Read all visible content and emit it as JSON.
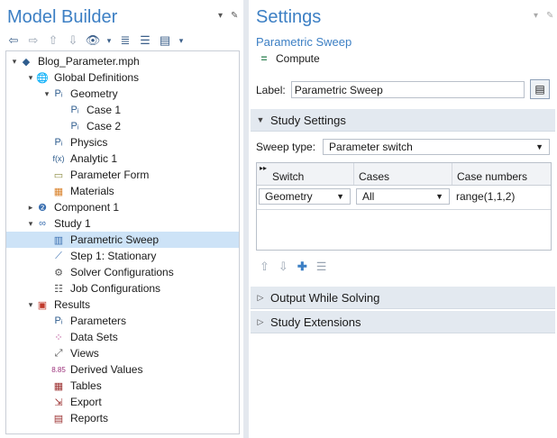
{
  "model_builder": {
    "title": "Model Builder",
    "tree": [
      {
        "label": "Blog_Parameter.mph",
        "icon": "model-file-icon",
        "toggle": "▾"
      },
      {
        "label": "Global Definitions",
        "icon": "globe-icon",
        "toggle": "▾"
      },
      {
        "label": "Geometry",
        "icon": "parameter-group-icon",
        "toggle": "▾"
      },
      {
        "label": "Case 1",
        "icon": "parameter-case-icon",
        "toggle": ""
      },
      {
        "label": "Case 2",
        "icon": "parameter-case-icon",
        "toggle": ""
      },
      {
        "label": "Physics",
        "icon": "parameter-group-icon",
        "toggle": ""
      },
      {
        "label": "Analytic 1",
        "icon": "function-icon",
        "toggle": ""
      },
      {
        "label": "Parameter Form",
        "icon": "folder-icon",
        "toggle": ""
      },
      {
        "label": "Materials",
        "icon": "materials-icon",
        "toggle": ""
      },
      {
        "label": "Component 1",
        "icon": "component-icon",
        "toggle": "▸"
      },
      {
        "label": "Study 1",
        "icon": "study-icon",
        "toggle": "▾"
      },
      {
        "label": "Parametric Sweep",
        "icon": "parametric-sweep-icon",
        "toggle": ""
      },
      {
        "label": "Step 1: Stationary",
        "icon": "stationary-step-icon",
        "toggle": ""
      },
      {
        "label": "Solver Configurations",
        "icon": "solver-config-icon",
        "toggle": ""
      },
      {
        "label": "Job Configurations",
        "icon": "job-config-icon",
        "toggle": ""
      },
      {
        "label": "Results",
        "icon": "results-icon",
        "toggle": "▾"
      },
      {
        "label": "Parameters",
        "icon": "parameter-group-icon",
        "toggle": ""
      },
      {
        "label": "Data Sets",
        "icon": "datasets-icon",
        "toggle": ""
      },
      {
        "label": "Views",
        "icon": "views-icon",
        "toggle": ""
      },
      {
        "label": "Derived Values",
        "icon": "derived-values-icon",
        "toggle": ""
      },
      {
        "label": "Tables",
        "icon": "tables-icon",
        "toggle": ""
      },
      {
        "label": "Export",
        "icon": "export-icon",
        "toggle": ""
      },
      {
        "label": "Reports",
        "icon": "reports-icon",
        "toggle": ""
      }
    ],
    "selected_item": "Parametric Sweep"
  },
  "settings": {
    "title": "Settings",
    "subtitle": "Parametric Sweep",
    "compute_label": "Compute",
    "label_field_label": "Label:",
    "label_field_value": "Parametric Sweep",
    "study_settings_title": "Study Settings",
    "sweep_type_label": "Sweep type:",
    "sweep_type_value": "Parameter switch",
    "table": {
      "columns": [
        "Switch",
        "Cases",
        "Case numbers"
      ],
      "rows": [
        {
          "switch": "Geometry",
          "cases": "All",
          "case_numbers": "range(1,1,2)"
        }
      ]
    },
    "output_while_solving_title": "Output While Solving",
    "study_extensions_title": "Study Extensions"
  },
  "colors": {
    "accent": "#3c7fc4",
    "selection": "#cde3f7",
    "section_bg": "#e3e9f0"
  }
}
